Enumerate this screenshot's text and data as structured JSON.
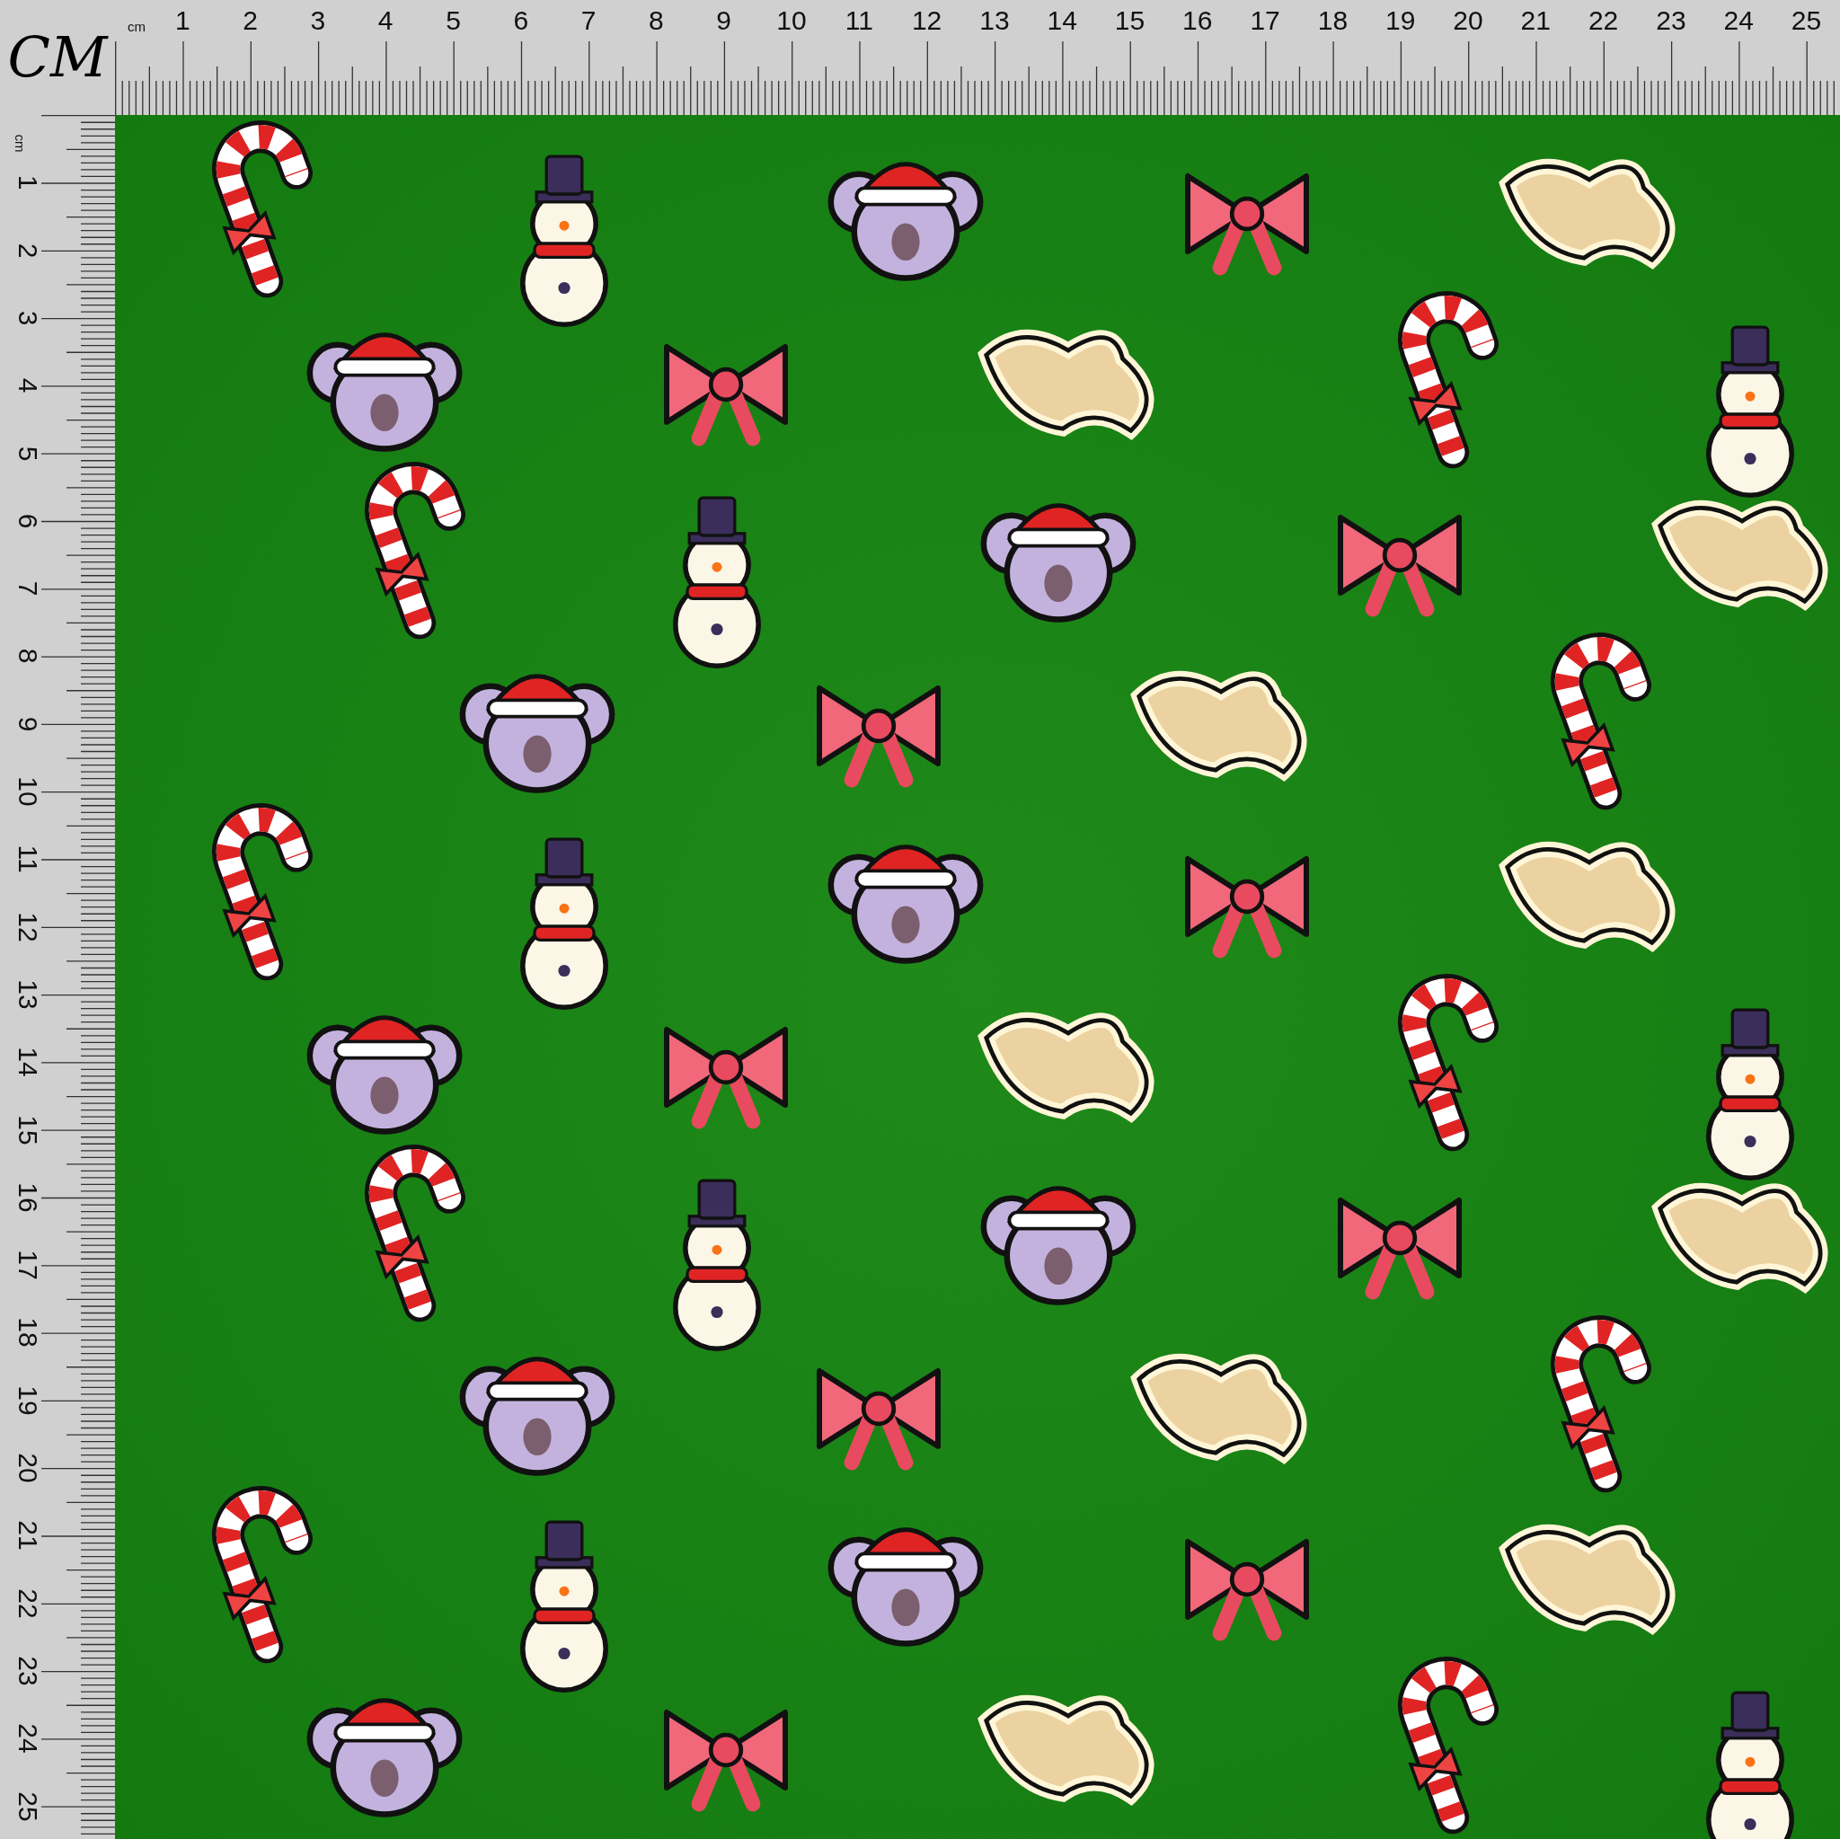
{
  "corner_label": "CM",
  "top_ruler": {
    "unit": "cm",
    "labels": [
      "1",
      "2",
      "3",
      "4",
      "5",
      "6",
      "7",
      "8",
      "9",
      "10",
      "11",
      "12",
      "13",
      "14",
      "15",
      "16",
      "17",
      "18",
      "19",
      "20",
      "21",
      "22",
      "23",
      "24",
      "25"
    ]
  },
  "left_ruler": {
    "unit": "cm",
    "labels": [
      "1",
      "2",
      "3",
      "4",
      "5",
      "6",
      "7",
      "8",
      "9",
      "10",
      "11",
      "12",
      "13",
      "14",
      "15",
      "16",
      "17",
      "18",
      "19",
      "20",
      "21",
      "22",
      "23",
      "24",
      "25"
    ]
  }
}
